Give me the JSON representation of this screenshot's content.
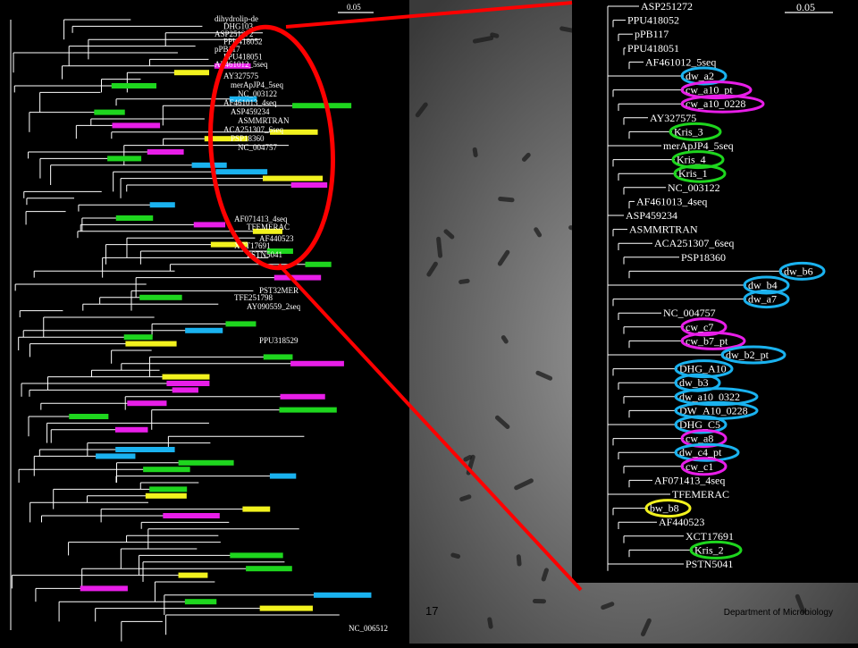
{
  "slide": {
    "number": "17",
    "department": "Department of Microbiology"
  },
  "colors": {
    "background": "#000000",
    "tree_line": "#ffffff",
    "highlight_red": "#ff0000",
    "cyan": "#1ab2ef",
    "magenta": "#e81ee8",
    "green": "#1ed61e",
    "yellow": "#f2f21e"
  },
  "left_tree": {
    "scale_label": "0.05",
    "top_labels": [
      "dihydrolip-de",
      "DHG103",
      "ASP251272",
      "PPU418052",
      "pPB117",
      "PPU418051",
      "AF461012_5seq"
    ],
    "mid_labels": [
      "AY327575",
      "merApJP4_5seq",
      "NC_003122",
      "AF461013_4seq",
      "ASP459234",
      "ASMMRTRAN",
      "ACA251307_6seq",
      "PSP18360",
      "NC_004757"
    ],
    "low_labels": [
      "AF071413_4seq",
      "TFEMERAC",
      "AF440523",
      "XCT17691",
      "PSTN5041",
      "PST32MER",
      "TFE251798",
      "AY090559_2seq",
      "PPU318529",
      "NC_006512"
    ]
  },
  "zoom_tree": {
    "scale_label": "0.05",
    "leaves": [
      {
        "label": "ASP251272",
        "color": null
      },
      {
        "label": "PPU418052",
        "color": null
      },
      {
        "label": "pPB117",
        "color": null
      },
      {
        "label": "PPU418051",
        "color": null
      },
      {
        "label": "AF461012_5seq",
        "color": null
      },
      {
        "label": "dw_a2",
        "color": "cyan"
      },
      {
        "label": "cw_a10_pt",
        "color": "magenta"
      },
      {
        "label": "cw_a10_0228",
        "color": "magenta"
      },
      {
        "label": "AY327575",
        "color": null
      },
      {
        "label": "Kris_3",
        "color": "green"
      },
      {
        "label": "merApJP4_5seq",
        "color": null
      },
      {
        "label": "Kris_4",
        "color": "green"
      },
      {
        "label": "Kris_1",
        "color": "green"
      },
      {
        "label": "NC_003122",
        "color": null
      },
      {
        "label": "AF461013_4seq",
        "color": null
      },
      {
        "label": "ASP459234",
        "color": null
      },
      {
        "label": "ASMMRTRAN",
        "color": null
      },
      {
        "label": "ACA251307_6seq",
        "color": null
      },
      {
        "label": "PSP18360",
        "color": null
      },
      {
        "label": "dw_b6",
        "color": "cyan"
      },
      {
        "label": "dw_b4",
        "color": "cyan"
      },
      {
        "label": "dw_a7",
        "color": "cyan"
      },
      {
        "label": "NC_004757",
        "color": null
      },
      {
        "label": "cw_c7",
        "color": "magenta"
      },
      {
        "label": "cw_b7_pt",
        "color": "magenta"
      },
      {
        "label": "dw_b2_pt",
        "color": "cyan"
      },
      {
        "label": "DHG_A10",
        "color": "cyan"
      },
      {
        "label": "dw_b3",
        "color": "cyan"
      },
      {
        "label": "dw_a10_0322",
        "color": "cyan"
      },
      {
        "label": "DW_A10_0228",
        "color": "cyan"
      },
      {
        "label": "DHG_C5",
        "color": "cyan"
      },
      {
        "label": "cw_a8",
        "color": "magenta"
      },
      {
        "label": "dw_c4_pt",
        "color": "cyan"
      },
      {
        "label": "cw_c1",
        "color": "magenta"
      },
      {
        "label": "AF071413_4seq",
        "color": null
      },
      {
        "label": "TFEMERAC",
        "color": null
      },
      {
        "label": "bw_b8",
        "color": "yellow"
      },
      {
        "label": "AF440523",
        "color": null
      },
      {
        "label": "XCT17691",
        "color": null
      },
      {
        "label": "Kris_2",
        "color": "green"
      },
      {
        "label": "PSTN5041",
        "color": null
      }
    ]
  }
}
